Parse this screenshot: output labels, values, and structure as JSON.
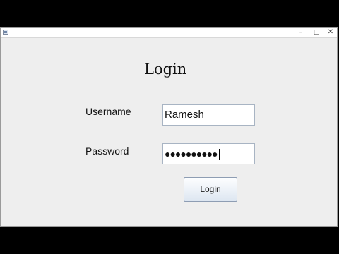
{
  "window": {
    "title": "",
    "controls": {
      "minimize": "–",
      "maximize": "□",
      "close": "✕"
    }
  },
  "form": {
    "heading": "Login",
    "username_label": "Username",
    "username_value": "Ramesh",
    "password_label": "Password",
    "password_mask": "●●●●●●●●●●",
    "login_button": "Login"
  }
}
